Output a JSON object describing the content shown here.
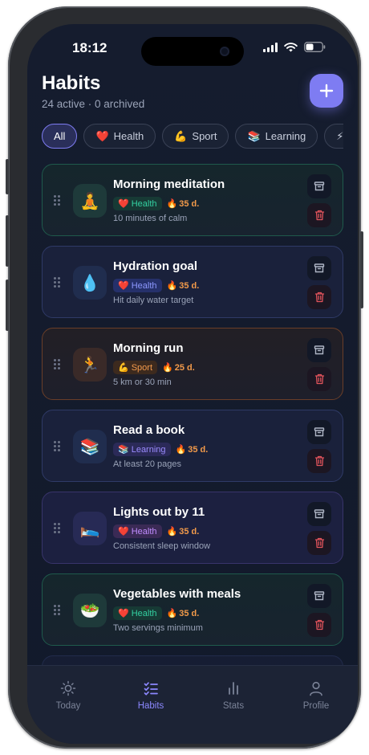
{
  "status": {
    "time": "18:12"
  },
  "header": {
    "title": "Habits",
    "subtitle": "24 active · 0 archived",
    "add_label": "+"
  },
  "filters": [
    {
      "label": "All",
      "emoji": ""
    },
    {
      "label": "Health",
      "emoji": "❤️"
    },
    {
      "label": "Sport",
      "emoji": "💪"
    },
    {
      "label": "Learning",
      "emoji": "📚"
    },
    {
      "label": "",
      "emoji": "⚡"
    }
  ],
  "habits": [
    {
      "title": "Morning meditation",
      "emoji": "🧘",
      "category": "Health",
      "category_emoji": "❤️",
      "streak": "35 d.",
      "desc": "10 minutes of calm"
    },
    {
      "title": "Hydration goal",
      "emoji": "💧",
      "category": "Health",
      "category_emoji": "❤️",
      "streak": "35 d.",
      "desc": "Hit daily water target"
    },
    {
      "title": "Morning run",
      "emoji": "🏃",
      "category": "Sport",
      "category_emoji": "💪",
      "streak": "25 d.",
      "desc": "5 km or 30 min"
    },
    {
      "title": "Read a book",
      "emoji": "📚",
      "category": "Learning",
      "category_emoji": "📚",
      "streak": "35 d.",
      "desc": "At least 20 pages"
    },
    {
      "title": "Lights out by 11",
      "emoji": "🛌",
      "category": "Health",
      "category_emoji": "❤️",
      "streak": "35 d.",
      "desc": "Consistent sleep window"
    },
    {
      "title": "Vegetables with meals",
      "emoji": "🥗",
      "category": "Health",
      "category_emoji": "❤️",
      "streak": "35 d.",
      "desc": "Two servings minimum"
    }
  ],
  "tabs": [
    {
      "label": "Today",
      "icon": "sun-icon"
    },
    {
      "label": "Habits",
      "icon": "checklist-icon"
    },
    {
      "label": "Stats",
      "icon": "bar-chart-icon"
    },
    {
      "label": "Profile",
      "icon": "user-icon"
    }
  ],
  "colors": {
    "accent": "#7e7cf2",
    "background": "#141b2d",
    "streak": "#f29a4a"
  }
}
